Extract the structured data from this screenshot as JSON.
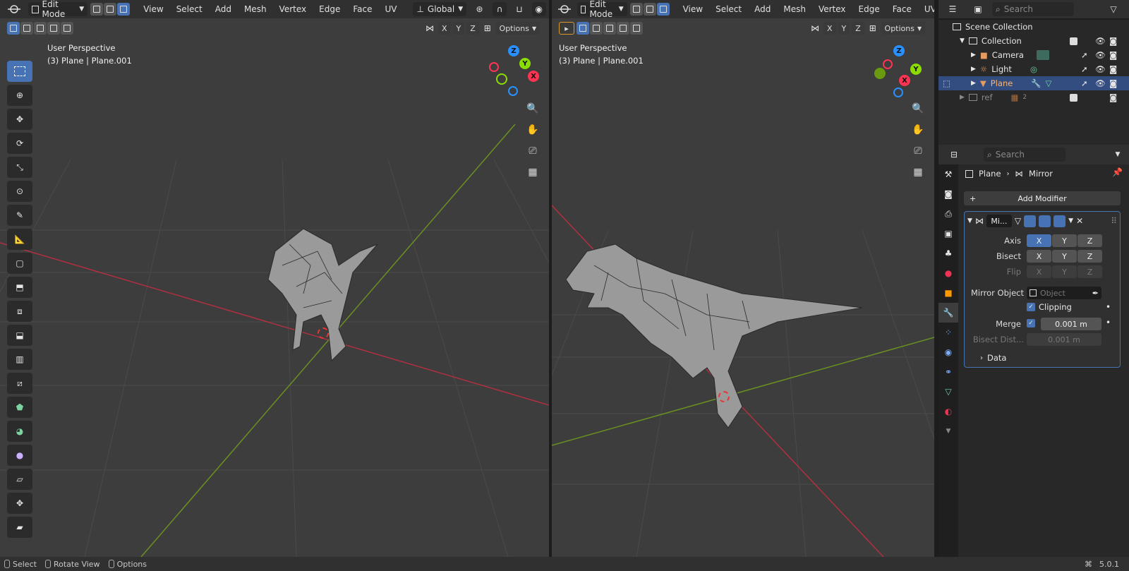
{
  "left_header": {
    "mode": "Edit Mode",
    "menus": [
      "View",
      "Select",
      "Add",
      "Mesh",
      "Vertex",
      "Edge",
      "Face",
      "UV"
    ],
    "transform": "Global"
  },
  "right_header": {
    "mode": "Edit Mode",
    "menus": [
      "View",
      "Select",
      "Add",
      "Mesh",
      "Vertex",
      "Edge",
      "Face",
      "UV"
    ]
  },
  "viewport_left": {
    "line1": "User Perspective",
    "line2": "(3) Plane | Plane.001",
    "axes": [
      "X",
      "Y",
      "Z"
    ],
    "options": "Options"
  },
  "viewport_right": {
    "line1": "User Perspective",
    "line2": "(3) Plane | Plane.001",
    "axes": [
      "X",
      "Y",
      "Z"
    ],
    "options": "Options"
  },
  "gizmo": {
    "x": "X",
    "y": "Y",
    "z": "Z"
  },
  "outliner": {
    "search_placeholder": "Search",
    "root": "Scene Collection",
    "collection": "Collection",
    "items": [
      "Camera",
      "Light",
      "Plane"
    ],
    "ref": "ref",
    "ref_count": "2"
  },
  "properties": {
    "search_placeholder": "Search",
    "breadcrumb_object": "Plane",
    "breadcrumb_modifier": "Mirror",
    "add_modifier": "Add Modifier",
    "modifier_name": "Mi...",
    "axis_label": "Axis",
    "bisect_label": "Bisect",
    "flip_label": "Flip",
    "x": "X",
    "y": "Y",
    "z": "Z",
    "mirror_object_label": "Mirror Object",
    "mirror_object_placeholder": "Object",
    "clipping_label": "Clipping",
    "merge_label": "Merge",
    "merge_value": "0.001 m",
    "bisect_dist_label": "Bisect Dist...",
    "bisect_dist_value": "0.001 m",
    "data_label": "Data"
  },
  "status": {
    "select": "Select",
    "rotate": "Rotate View",
    "options": "Options",
    "version": "5.0.1"
  },
  "colors": {
    "accent": "#4772b3",
    "x_axis": "#ff3352",
    "y_axis": "#8bdc00",
    "z_axis": "#2890ff"
  }
}
